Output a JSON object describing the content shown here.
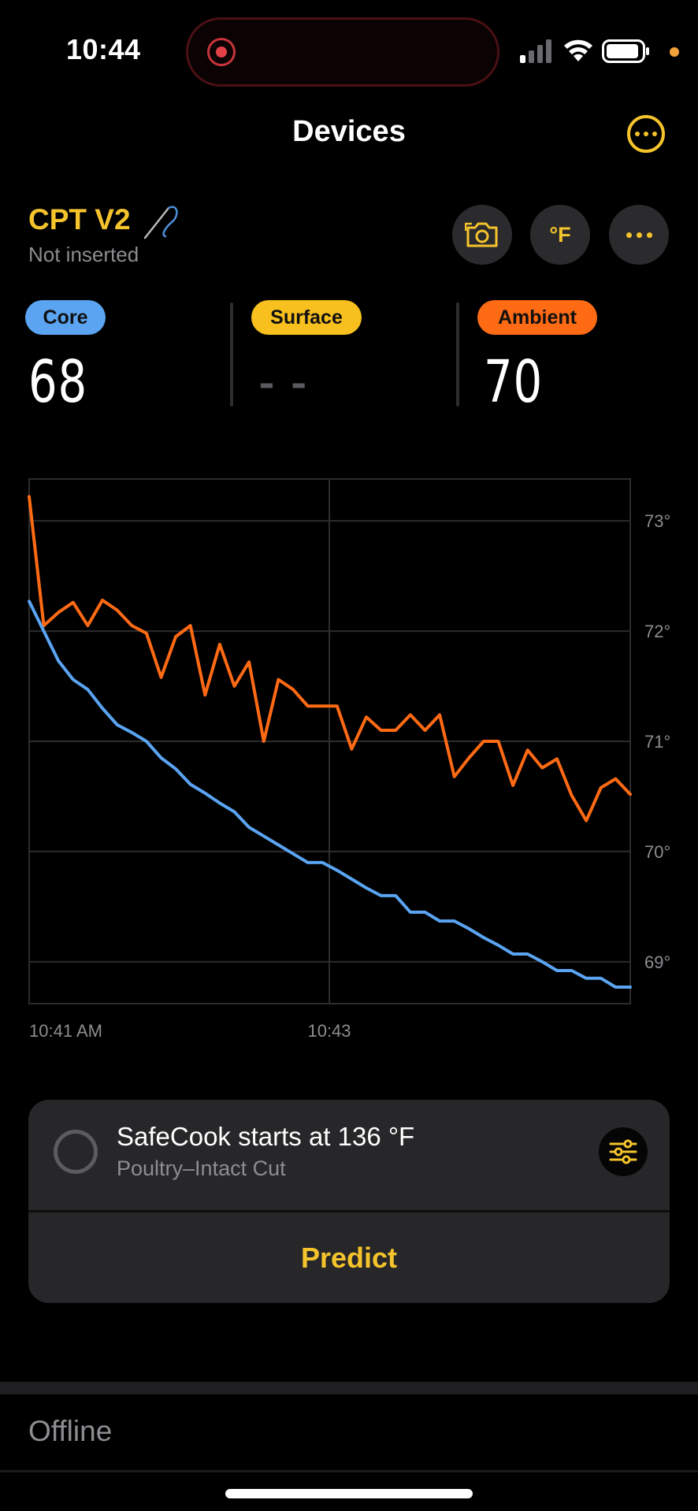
{
  "status_bar": {
    "time": "10:44",
    "icons": [
      "screen-recording-icon",
      "signal-icon",
      "wifi-icon",
      "battery-icon",
      "privacy-dot-icon"
    ]
  },
  "header": {
    "title": "Devices",
    "more_icon": "ellipsis-circle-icon"
  },
  "device": {
    "name": "CPT V2",
    "status": "Not inserted",
    "probe_icon": "probe-icon",
    "buttons": {
      "camera_icon": "camera-icon",
      "unit_label": "°F",
      "more_icon": "ellipsis-icon"
    }
  },
  "readings": {
    "core": {
      "label": "Core",
      "value": "68",
      "color": "#5aa4f2"
    },
    "surface": {
      "label": "Surface",
      "value": "- -",
      "color": "#f8c01e"
    },
    "ambient": {
      "label": "Ambient",
      "value": "70",
      "color": "#ff6a14"
    }
  },
  "chart_data": {
    "type": "line",
    "x_tick_labels": [
      "10:41 AM",
      "10:43"
    ],
    "y_tick_labels": [
      "73°",
      "72°",
      "71°",
      "70°",
      "69°"
    ],
    "y_ticks": [
      73,
      72,
      71,
      70,
      69
    ],
    "ylim": [
      68.62,
      73.38
    ],
    "xlim": [
      0,
      41
    ],
    "grid": true,
    "series": [
      {
        "color": "#ff6a14",
        "x": [
          0,
          1,
          2,
          3,
          4,
          5,
          6,
          7,
          8,
          9,
          10,
          11,
          12,
          13,
          14,
          15,
          16,
          17,
          18,
          19,
          20,
          21,
          22,
          23,
          24,
          25,
          26,
          27,
          28,
          29,
          30,
          31,
          32,
          33,
          34,
          35,
          36,
          37,
          38,
          39,
          40,
          41
        ],
        "values": [
          73.22,
          72.05,
          72.17,
          72.26,
          72.05,
          72.28,
          72.19,
          72.05,
          71.98,
          71.58,
          71.95,
          72.05,
          71.42,
          71.88,
          71.5,
          71.72,
          71.0,
          71.56,
          71.47,
          71.32,
          71.32,
          71.32,
          70.93,
          71.22,
          71.1,
          71.1,
          71.24,
          71.1,
          71.24,
          70.68,
          70.85,
          71.0,
          71.0,
          70.6,
          70.92,
          70.76,
          70.84,
          70.51,
          70.28,
          70.58,
          70.66,
          70.52
        ]
      },
      {
        "color": "#5aa4f2",
        "x": [
          0,
          1,
          2,
          3,
          4,
          5,
          6,
          7,
          8,
          9,
          10,
          11,
          12,
          13,
          14,
          15,
          16,
          17,
          18,
          19,
          20,
          21,
          22,
          23,
          24,
          25,
          26,
          27,
          28,
          29,
          30,
          31,
          32,
          33,
          34,
          35,
          36,
          37,
          38,
          39,
          40,
          41
        ],
        "values": [
          72.27,
          72.0,
          71.73,
          71.56,
          71.47,
          71.3,
          71.15,
          71.08,
          71.0,
          70.85,
          70.75,
          70.61,
          70.53,
          70.44,
          70.36,
          70.22,
          70.14,
          70.06,
          69.98,
          69.9,
          69.9,
          69.83,
          69.75,
          69.67,
          69.6,
          69.6,
          69.45,
          69.45,
          69.37,
          69.37,
          69.3,
          69.22,
          69.15,
          69.07,
          69.07,
          69.0,
          68.92,
          68.92,
          68.85,
          68.85,
          68.77,
          68.77
        ]
      }
    ]
  },
  "safecook": {
    "title": "SafeCook starts at 136 °F",
    "subtitle": "Poultry–Intact Cut",
    "settings_icon": "sliders-icon",
    "predict_label": "Predict"
  },
  "footer": {
    "status": "Offline"
  }
}
